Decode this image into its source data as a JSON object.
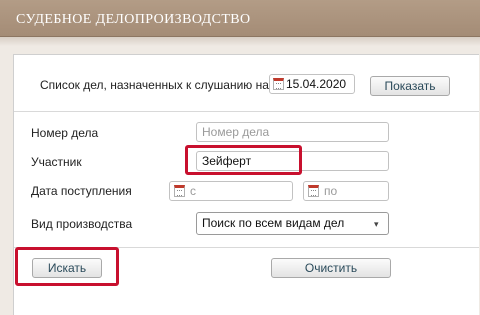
{
  "header": {
    "title": "СУДЕБНОЕ ДЕЛОПРОИЗВОДСТВО"
  },
  "schedule": {
    "label": "Список дел, назначенных к слушанию на",
    "date": "15.04.2020",
    "show_button": "Показать"
  },
  "form": {
    "case_number": {
      "label": "Номер дела",
      "placeholder": "Номер дела",
      "value": ""
    },
    "participant": {
      "label": "Участник",
      "value": "Зейферт"
    },
    "received": {
      "label": "Дата поступления",
      "from_placeholder": "с",
      "to_placeholder": "по"
    },
    "proceeding": {
      "label": "Вид производства",
      "selected": "Поиск по всем видам дел"
    }
  },
  "actions": {
    "search_button": "Искать",
    "clear_button": "Очистить"
  },
  "colors": {
    "header": "#a8917b",
    "highlight": "#c8102e",
    "accent_text": "#2a4a5a"
  },
  "icons": {
    "calendar": "calendar-icon",
    "dropdown": "chevron-down-icon"
  }
}
